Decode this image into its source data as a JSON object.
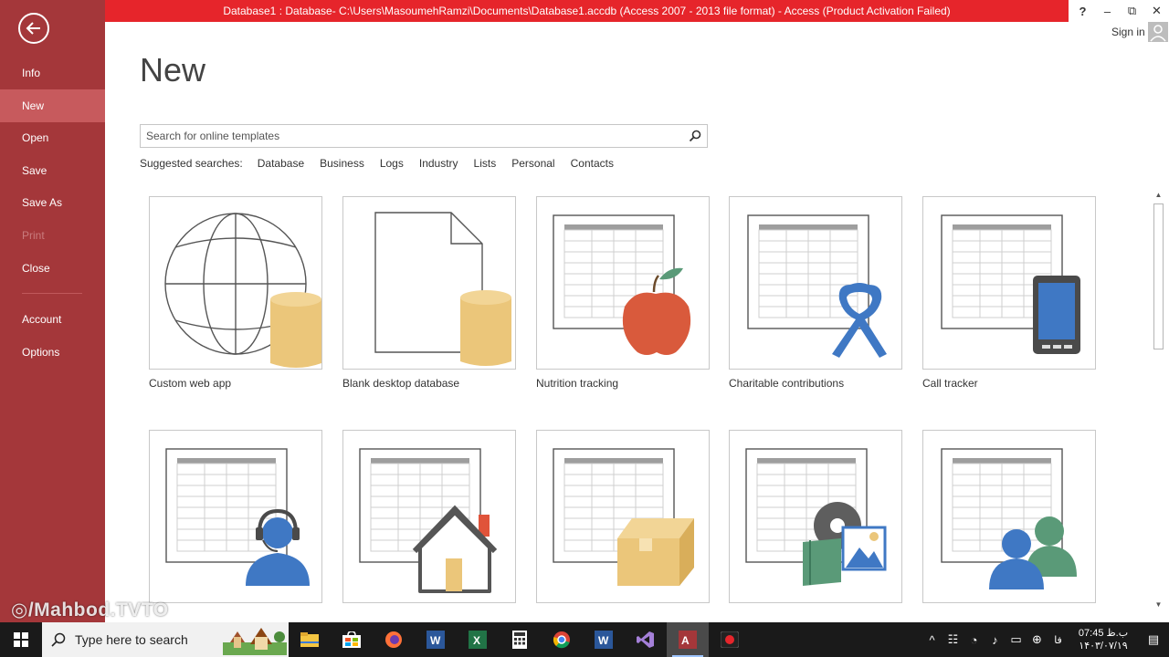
{
  "titlebar": {
    "text": "Database1 : Database- C:\\Users\\MasoumehRamzi\\Documents\\Database1.accdb (Access 2007 - 2013 file format)  -  Access (Product Activation Failed)",
    "help": "?",
    "minimize": "–",
    "restore": "⧉",
    "close": "✕",
    "signin": "Sign in"
  },
  "sidebar": {
    "items": [
      {
        "label": "Info"
      },
      {
        "label": "New"
      },
      {
        "label": "Open"
      },
      {
        "label": "Save"
      },
      {
        "label": "Save As"
      },
      {
        "label": "Print"
      },
      {
        "label": "Close"
      },
      {
        "label": "Account"
      },
      {
        "label": "Options"
      }
    ]
  },
  "main": {
    "title": "New",
    "search_placeholder": "Search for online templates",
    "suggested_label": "Suggested searches:",
    "suggested": [
      "Database",
      "Business",
      "Logs",
      "Industry",
      "Lists",
      "Personal",
      "Contacts"
    ],
    "templates": [
      {
        "label": "Custom web app",
        "icon": "globe-database-icon"
      },
      {
        "label": "Blank desktop database",
        "icon": "blank-document-database-icon"
      },
      {
        "label": "Nutrition tracking",
        "icon": "table-apple-icon"
      },
      {
        "label": "Charitable contributions",
        "icon": "table-ribbon-icon"
      },
      {
        "label": "Call tracker",
        "icon": "table-phone-icon"
      },
      {
        "label": "",
        "icon": "table-headset-person-icon"
      },
      {
        "label": "",
        "icon": "table-house-icon"
      },
      {
        "label": "",
        "icon": "table-box-icon"
      },
      {
        "label": "",
        "icon": "table-media-icon"
      },
      {
        "label": "",
        "icon": "table-people-icon"
      }
    ]
  },
  "watermark": "/Mahbod.TVTO",
  "taskbar": {
    "search_placeholder": "Type here to search",
    "apps": [
      "file-explorer-icon",
      "store-icon",
      "firefox-icon",
      "word-icon",
      "excel-icon",
      "calculator-icon",
      "chrome-icon",
      "word-icon",
      "visual-studio-icon",
      "access-icon",
      "recorder-icon"
    ],
    "clock_time": "07:45 ب.ظ",
    "clock_date": "۱۴۰۳/۰۷/۱۹",
    "language": "فا"
  },
  "colors": {
    "accent": "#a4373a",
    "titlebar": "#e6252b",
    "active_nav": "#c75a5d"
  }
}
